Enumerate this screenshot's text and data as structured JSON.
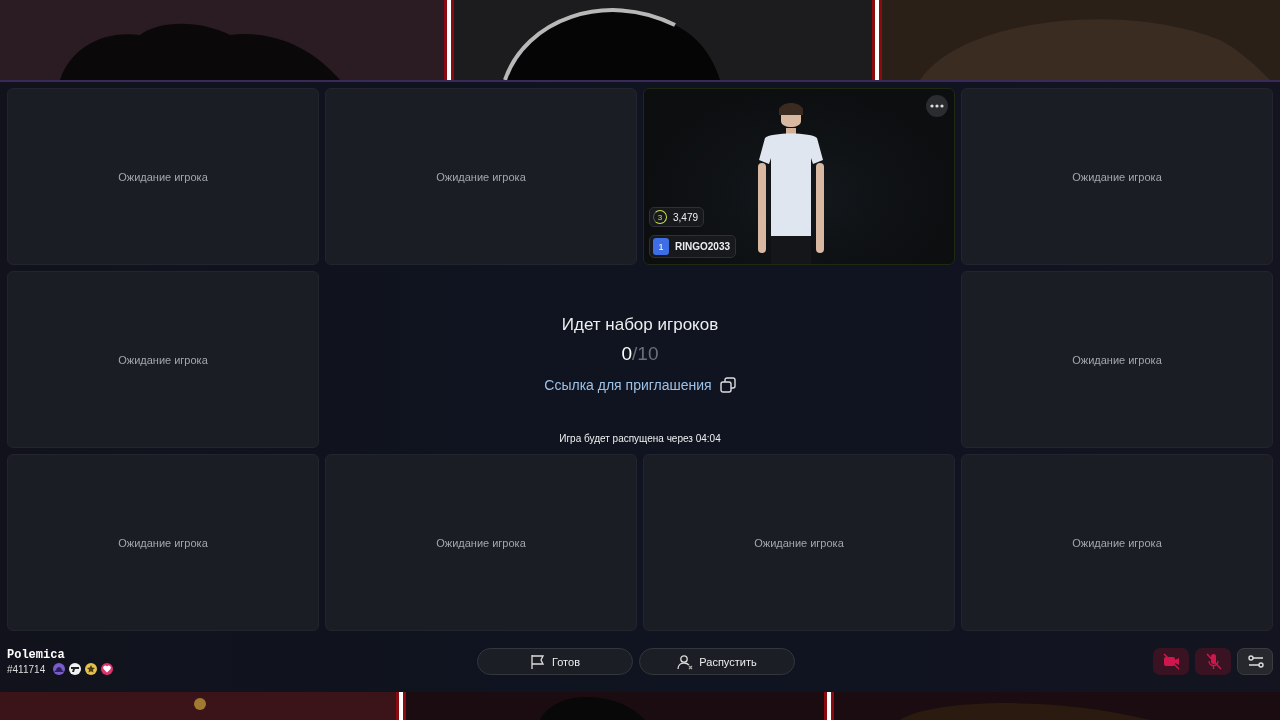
{
  "lobby": {
    "title": "Идет набор игроков",
    "count_joined": "0",
    "count_total": "/10",
    "invite_link": "Ссылка для приглашения",
    "disband_notice": "Игра будет распущена через 04:04"
  },
  "slots": [
    {
      "kind": "waiting",
      "label": "Ожидание игрока"
    },
    {
      "kind": "waiting",
      "label": "Ожидание игрока"
    },
    {
      "kind": "player",
      "level": "3",
      "score": "3,479",
      "rank": "1",
      "name": "RINGO2033"
    },
    {
      "kind": "waiting",
      "label": "Ожидание игрока"
    },
    {
      "kind": "waiting",
      "label": "Ожидание игрока"
    },
    {
      "kind": "waiting",
      "label": "Ожидание игрока"
    },
    {
      "kind": "waiting",
      "label": "Ожидание игрока"
    },
    {
      "kind": "waiting",
      "label": "Ожидание игрока"
    },
    {
      "kind": "waiting",
      "label": "Ожидание игрока"
    },
    {
      "kind": "waiting",
      "label": "Ожидание игрока"
    }
  ],
  "user": {
    "name": "Polemica",
    "id": "#411714",
    "badges": [
      {
        "kind": "hat",
        "color": "#7a5cc8"
      },
      {
        "kind": "gun",
        "color": "#f2f2f2"
      },
      {
        "kind": "star",
        "color": "#e3c24e"
      },
      {
        "kind": "heart",
        "color": "#e0326c"
      }
    ]
  },
  "actions": [
    {
      "kind": "ready",
      "label": "Готов"
    },
    {
      "kind": "disband",
      "label": "Распустить"
    }
  ],
  "media": [
    {
      "kind": "camera",
      "muted": true
    },
    {
      "kind": "mic",
      "muted": true
    }
  ]
}
